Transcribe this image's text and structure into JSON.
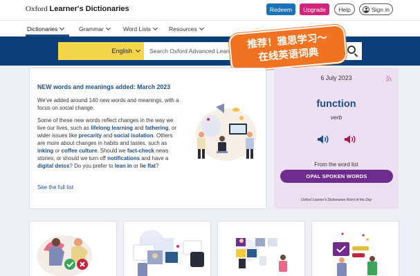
{
  "header": {
    "logo_light": "Oxford",
    "logo_bold": "Learner's Dictionaries",
    "redeem_label": "Redeem",
    "upgrade_label": "Upgrade",
    "help_label": "Help",
    "signin_label": "Sign in"
  },
  "nav": {
    "items": [
      {
        "label": "Dictionaries"
      },
      {
        "label": "Grammar"
      },
      {
        "label": "Word Lists"
      },
      {
        "label": "Resources"
      }
    ]
  },
  "search": {
    "language": "English",
    "placeholder": "Search Oxford Advanced Learner's Dictionary"
  },
  "promo": {
    "line1": "推荐！雅思学习～",
    "line2": "在线英语词典"
  },
  "news": {
    "title": "NEW words and meanings added: March 2023",
    "intro": "We've added around 140 new words and meanings, with a focus on social change.",
    "body": [
      {
        "t": "Some of these new words reflect changes in the way we live our lives, such as "
      },
      {
        "t": "lifelong learning",
        "k": true
      },
      {
        "t": " and "
      },
      {
        "t": "fathering",
        "k": true
      },
      {
        "t": ", or wider issues like "
      },
      {
        "t": "precarity",
        "k": true
      },
      {
        "t": " and "
      },
      {
        "t": "social isolation",
        "k": true
      },
      {
        "t": ". Others are more about changes in habits and tastes, such as "
      },
      {
        "t": "inking",
        "k": true
      },
      {
        "t": " or "
      },
      {
        "t": "coffee culture",
        "k": true
      },
      {
        "t": ". Should we "
      },
      {
        "t": "fact-check",
        "k": true
      },
      {
        "t": " news stories, or should we turn off "
      },
      {
        "t": "notifications",
        "k": true
      },
      {
        "t": " and have a "
      },
      {
        "t": "digital detox",
        "k": true
      },
      {
        "t": "? Do you prefer to "
      },
      {
        "t": "lean in",
        "k": true
      },
      {
        "t": " or "
      },
      {
        "t": "lie flat",
        "k": true
      },
      {
        "t": "?"
      }
    ],
    "see_full_list": "See the full list"
  },
  "word_of_the_day": {
    "date": "6 July 2023",
    "word": "function",
    "part_of_speech": "verb",
    "from_label": "From the word list",
    "list_button": "OPAL SPOKEN WORDS",
    "caption": "Oxford Learner's Dictionaries Word of the Day",
    "colors": {
      "uk_speaker": "#1f4e86",
      "us_speaker": "#b0164e",
      "button": "#6e2d8e",
      "background": "#ecdff1"
    }
  },
  "tiles": [
    {
      "illustration": "two-people-with-check-and-cross-illustration"
    },
    {
      "illustration": "video-screens-illustration"
    },
    {
      "illustration": "puzzle-blocks-people-illustration"
    },
    {
      "illustration": "quiz-people-illustration"
    }
  ],
  "colors": {
    "brand_blue": "#0b3f7a",
    "link_blue": "#1f4e86",
    "redeem": "#1a72b8",
    "upgrade": "#d4247a",
    "language_select": "#f3d64c",
    "promo": "#f07322"
  }
}
